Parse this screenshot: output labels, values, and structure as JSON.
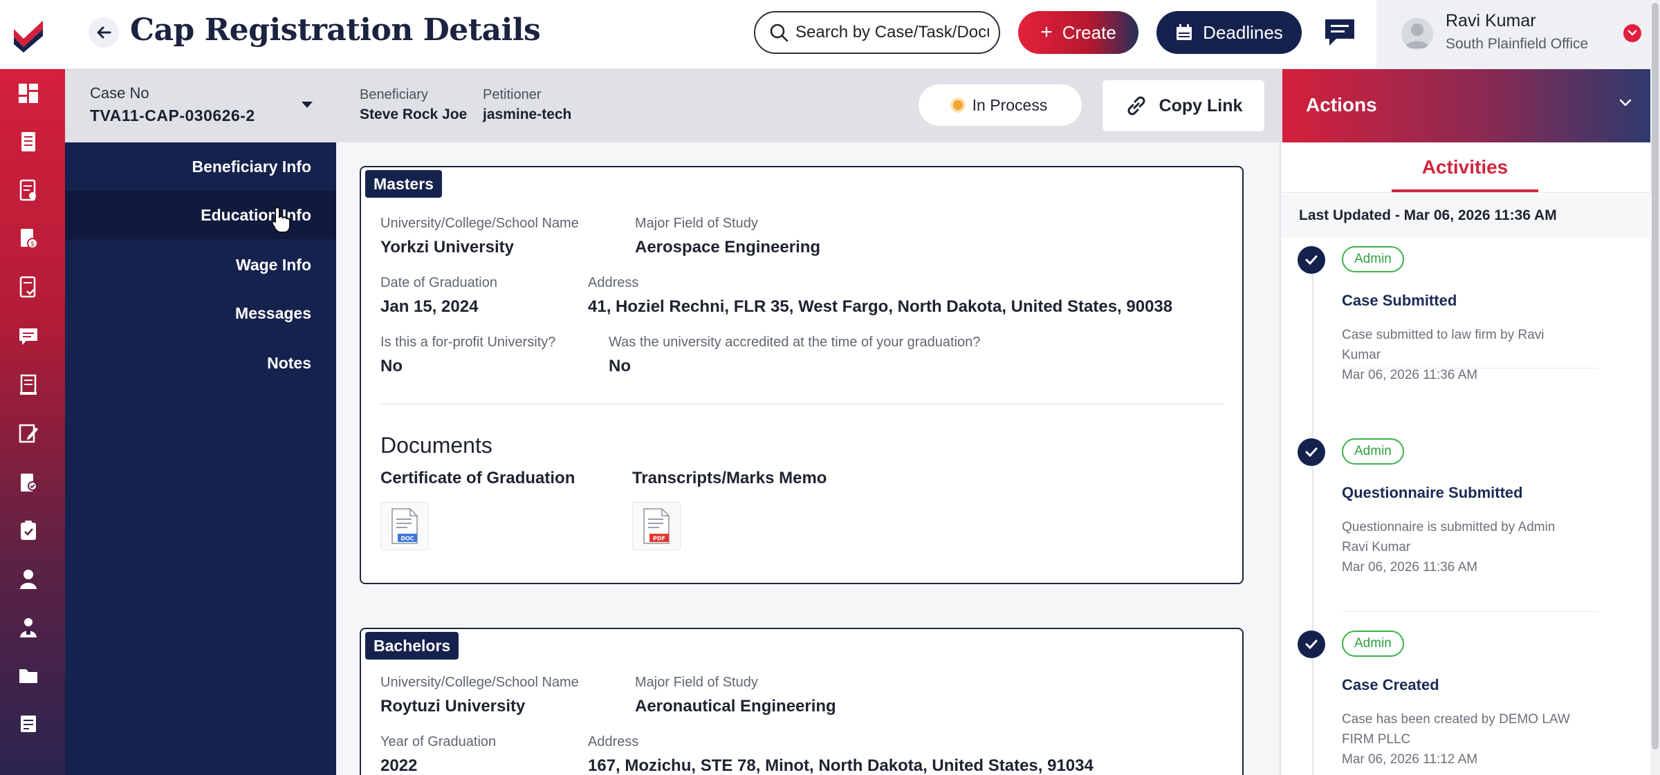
{
  "header": {
    "title": "Cap Registration Details",
    "search_placeholder": "Search by Case/Task/Document",
    "create_label": "Create",
    "deadlines_label": "Deadlines",
    "user": {
      "name": "Ravi Kumar",
      "office": "South Plainfield Office"
    }
  },
  "case": {
    "case_no_label": "Case No",
    "case_no": "TVA11-CAP-030626-2",
    "beneficiary_label": "Beneficiary",
    "beneficiary": "Steve Rock Joe",
    "petitioner_label": "Petitioner",
    "petitioner": "jasmine-tech",
    "status": "In Process",
    "copy_link_label": "Copy Link"
  },
  "section_nav": {
    "items": [
      "Beneficiary Info",
      "Education Info",
      "Wage Info",
      "Messages",
      "Notes"
    ],
    "active": "Education Info"
  },
  "education": {
    "masters": {
      "tag": "Masters",
      "university_label": "University/College/School Name",
      "university": "Yorkzi University",
      "major_label": "Major Field of Study",
      "major": "Aerospace Engineering",
      "date_label": "Date of Graduation",
      "date": "Jan 15, 2024",
      "address_label": "Address",
      "address": "41, Hoziel Rechni, FLR 35, West Fargo, North Dakota, United States, 90038",
      "for_profit_label": "Is this a for-profit University?",
      "for_profit": "No",
      "accredited_label": "Was the university accredited at the time of your graduation?",
      "accredited": "No",
      "documents_title": "Documents",
      "documents": [
        {
          "name": "Certificate of Graduation",
          "type": "DOC"
        },
        {
          "name": "Transcripts/Marks Memo",
          "type": "PDF"
        }
      ]
    },
    "bachelors": {
      "tag": "Bachelors",
      "university_label": "University/College/School Name",
      "university": "Roytuzi University",
      "major_label": "Major Field of Study",
      "major": "Aeronautical Engineering",
      "year_label": "Year of Graduation",
      "year": "2022",
      "address_label": "Address",
      "address": "167, Mozichu, STE 78, Minot, North Dakota, United States, 91034"
    }
  },
  "actions": {
    "title": "Actions",
    "tab": "Activities",
    "last_updated": "Last Updated - Mar 06, 2026 11:36 AM",
    "activities": [
      {
        "badge": "Admin",
        "title": "Case Submitted",
        "desc": "Case submitted to law firm by Ravi Kumar",
        "time": "Mar 06, 2026 11:36 AM"
      },
      {
        "badge": "Admin",
        "title": "Questionnaire Submitted",
        "desc": "Questionnaire is submitted by Admin Ravi Kumar",
        "time": "Mar 06, 2026 11:36 AM"
      },
      {
        "badge": "Admin",
        "title": "Case Created",
        "desc": "Case has been created by DEMO LAW FIRM PLLC",
        "time": "Mar 06, 2026 11:12 AM"
      }
    ]
  },
  "colors": {
    "brand_red": "#d4203c",
    "navy": "#15224d",
    "badge_green": "#3db24a",
    "status_orange": "#f2a531"
  },
  "icons": {
    "rail": [
      "dashboard-icon",
      "cases-icon",
      "forms-icon",
      "billing-icon",
      "tasks-icon",
      "messages-icon",
      "documents-icon",
      "notes-icon",
      "reports-icon",
      "clipboard-icon",
      "user-icon",
      "users-icon",
      "folder-icon",
      "templates-icon"
    ]
  }
}
